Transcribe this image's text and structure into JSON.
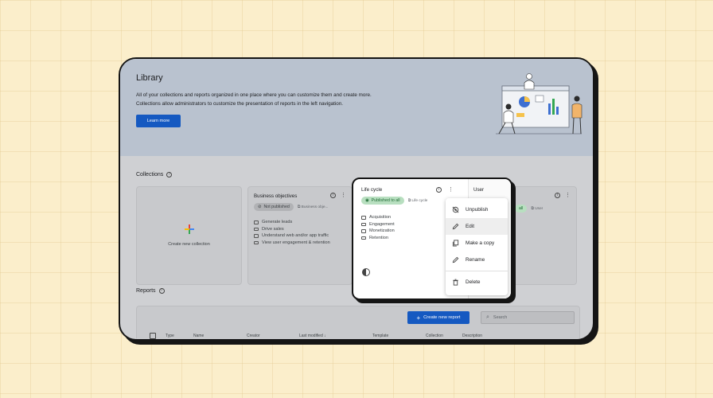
{
  "hero": {
    "title": "Library",
    "description_line1": "All of your collections and reports organized in one place where you can customize them and create more.",
    "description_line2": "Collections allow administrators to customize the presentation of reports in the left navigation.",
    "learn_more_label": "Learn more"
  },
  "collections": {
    "label": "Collections",
    "create_label": "Create new collection",
    "cards": [
      {
        "title": "Business objectives",
        "status": "Not published",
        "tag": "Business obje...",
        "items": [
          "Generate leads",
          "Drive sales",
          "Understand web and/or app traffic",
          "View user engagement & retention"
        ]
      },
      {
        "title": "Life cycle",
        "status": "Published to all",
        "tag": "Life cycle",
        "items": [
          "Acquisition",
          "Engagement",
          "Monetization",
          "Retention"
        ]
      },
      {
        "title": "User",
        "status_fragment": "all",
        "tag": "User"
      }
    ]
  },
  "context_menu": {
    "items": [
      {
        "label": "Unpublish",
        "icon": "unpublish-icon"
      },
      {
        "label": "Edit",
        "icon": "pencil-icon"
      },
      {
        "label": "Make a copy",
        "icon": "copy-icon"
      },
      {
        "label": "Rename",
        "icon": "pencil-icon"
      },
      {
        "label": "Delete",
        "icon": "trash-icon"
      }
    ]
  },
  "reports": {
    "label": "Reports",
    "create_label": "Create new report",
    "search_placeholder": "Search",
    "columns": [
      "Type",
      "Name",
      "Creator",
      "Last modified",
      "Template",
      "Collection",
      "Description"
    ]
  },
  "colors": {
    "background": "#fbeecb",
    "primary_button": "#1559c1",
    "published_pill": "#b8dfc0",
    "hero_bg": "#b9c2cf"
  }
}
